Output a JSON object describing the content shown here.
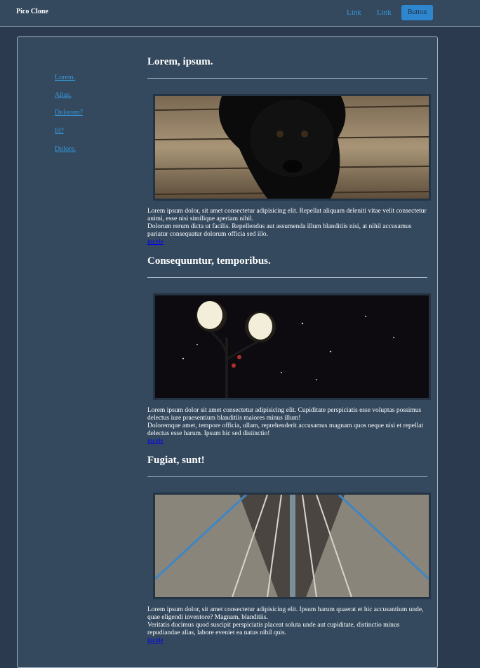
{
  "navbar": {
    "brand": "Pico Clone",
    "links": [
      "Link",
      "Link"
    ],
    "button_label": "Button"
  },
  "sidebar": {
    "items": [
      "Lorem.",
      "Alias.",
      "Dolorem?",
      "Id?",
      "Dolore."
    ]
  },
  "sections": [
    {
      "title": "Lorem, ipsum.",
      "para1": "Lorem ipsum dolor, sit amet consectetur adipisicing elit. Repellat aliquam deleniti vitae velit consectetur animi, esse nisi similique aperiam nihil.",
      "para2": "Dolorum rerum dicta ut facilis. Repellendus aut assumenda illum blanditiis nisi, at nihil accusamus pariatur consequatur dolorum officia sed illo.",
      "link": "incele"
    },
    {
      "title": "Consequuntur, temporibus.",
      "para1": "Lorem ipsum dolor sit amet consectetur adipisicing elit. Cupiditate perspiciatis esse voluptas possimus delectus iure praesentium blanditiis maiores minus illum!",
      "para2": "Doloremque amet, tempore officia, ullam, reprehenderit accusamus magnam quos neque nisi et repellat delectus esse harum. Ipsum hic sed distinctio!",
      "link": "incele"
    },
    {
      "title": "Fugiat, sunt!",
      "para1": "Lorem ipsum dolor, sit amet consectetur adipisicing elit. Ipsum harum quaerat et hic accusantium unde, quae eligendi inventore? Magnam, blanditiis.",
      "para2": "Veritatis ducimus quod suscipit perspiciatis placeat soluta unde aut cupiditate, distinctio minus repudiandae alias, labore eveniet ea natus nihil quis.",
      "link": "incele"
    }
  ],
  "colors": {
    "background": "#2b3a4e",
    "panel": "#34495e",
    "accent": "#3498db",
    "visited_link": "#0000ee"
  }
}
